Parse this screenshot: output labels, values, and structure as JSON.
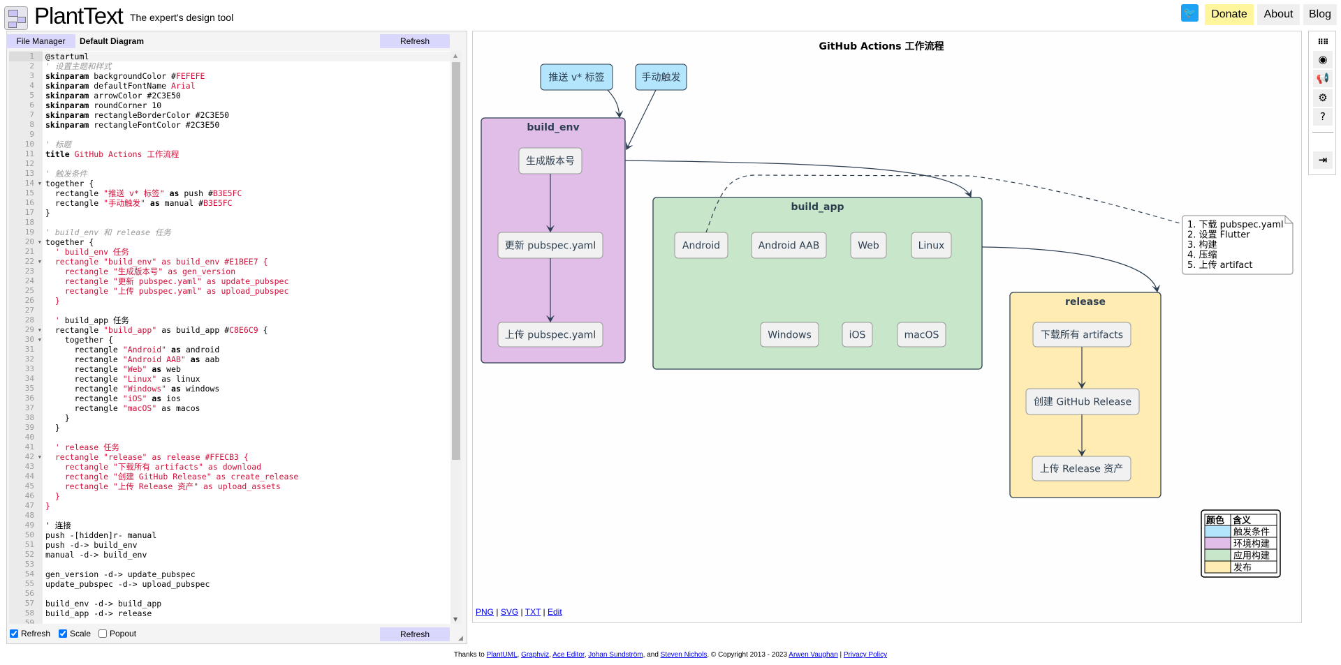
{
  "header": {
    "brand": "PlantText",
    "tagline": "The expert's design tool",
    "twitter_icon": "twitter-icon",
    "donate": "Donate",
    "about": "About",
    "blog": "Blog",
    "donate_color": "#fff59d"
  },
  "editor_toolbar": {
    "file_manager": "File Manager",
    "diagram_name": "Default Diagram",
    "refresh": "Refresh"
  },
  "editor": {
    "lines": [
      [
        [
          "t",
          "@startuml"
        ]
      ],
      [
        [
          "c",
          "' 设置主题和样式"
        ]
      ],
      [
        [
          "k",
          "skinparam"
        ],
        [
          "t",
          " backgroundColor #"
        ],
        [
          "s",
          "FEFEFE"
        ]
      ],
      [
        [
          "k",
          "skinparam"
        ],
        [
          "t",
          " defaultFontName "
        ],
        [
          "s",
          "Arial"
        ]
      ],
      [
        [
          "k",
          "skinparam"
        ],
        [
          "t",
          " arrowColor #2C3E50"
        ]
      ],
      [
        [
          "k",
          "skinparam"
        ],
        [
          "t",
          " roundCorner 10"
        ]
      ],
      [
        [
          "k",
          "skinparam"
        ],
        [
          "t",
          " rectangleBorderColor #2C3E50"
        ]
      ],
      [
        [
          "k",
          "skinparam"
        ],
        [
          "t",
          " rectangleFontColor #2C3E50"
        ]
      ],
      [],
      [
        [
          "c",
          "' 标题"
        ]
      ],
      [
        [
          "k",
          "title"
        ],
        [
          "s",
          " GitHub Actions 工作流程"
        ]
      ],
      [],
      [
        [
          "c",
          "' 触发条件"
        ]
      ],
      [
        [
          "t",
          "together {"
        ]
      ],
      [
        [
          "t",
          "  rectangle "
        ],
        [
          "s",
          "\"推送 v* 标签\""
        ],
        [
          "t",
          " "
        ],
        [
          "k",
          "as"
        ],
        [
          "t",
          " push #"
        ],
        [
          "s",
          "B3E5FC"
        ]
      ],
      [
        [
          "t",
          "  rectangle "
        ],
        [
          "s",
          "\"手动触发\""
        ],
        [
          "t",
          " "
        ],
        [
          "k",
          "as"
        ],
        [
          "t",
          " manual #"
        ],
        [
          "s",
          "B3E5FC"
        ]
      ],
      [
        [
          "t",
          "}"
        ]
      ],
      [],
      [
        [
          "c",
          "' build_env 和 release 任务"
        ]
      ],
      [
        [
          "t",
          "together {"
        ]
      ],
      [
        [
          "s",
          "  ' build_env 任务"
        ]
      ],
      [
        [
          "s",
          "  rectangle \"build_env\" as build_env #E1BEE7 {"
        ]
      ],
      [
        [
          "s",
          "    rectangle \"生成版本号\" as gen_version"
        ]
      ],
      [
        [
          "s",
          "    rectangle \"更新 pubspec.yaml\" as update_pubspec"
        ]
      ],
      [
        [
          "s",
          "    rectangle \"上传 pubspec.yaml\" as upload_pubspec"
        ]
      ],
      [
        [
          "s",
          "  }"
        ]
      ],
      [],
      [
        [
          "s",
          "  '"
        ],
        [
          "t",
          " build_app 任务"
        ]
      ],
      [
        [
          "t",
          "  rectangle "
        ],
        [
          "s",
          "\"build_app\""
        ],
        [
          "t",
          " as build_app #"
        ],
        [
          "s",
          "C8E6C9"
        ],
        [
          "t",
          " {"
        ]
      ],
      [
        [
          "t",
          "    together {"
        ]
      ],
      [
        [
          "t",
          "      rectangle "
        ],
        [
          "s",
          "\"Android\""
        ],
        [
          "t",
          " "
        ],
        [
          "k",
          "as"
        ],
        [
          "t",
          " android"
        ]
      ],
      [
        [
          "t",
          "      rectangle "
        ],
        [
          "s",
          "\"Android AAB\""
        ],
        [
          "t",
          " "
        ],
        [
          "k",
          "as"
        ],
        [
          "t",
          " aab"
        ]
      ],
      [
        [
          "t",
          "      rectangle "
        ],
        [
          "s",
          "\"Web\""
        ],
        [
          "t",
          " "
        ],
        [
          "k",
          "as"
        ],
        [
          "t",
          " web"
        ]
      ],
      [
        [
          "t",
          "      rectangle "
        ],
        [
          "s",
          "\"Linux\""
        ],
        [
          "t",
          " as linux"
        ]
      ],
      [
        [
          "t",
          "      rectangle "
        ],
        [
          "s",
          "\"Windows\""
        ],
        [
          "t",
          " "
        ],
        [
          "k",
          "as"
        ],
        [
          "t",
          " windows"
        ]
      ],
      [
        [
          "t",
          "      rectangle "
        ],
        [
          "s",
          "\"iOS\""
        ],
        [
          "t",
          " "
        ],
        [
          "k",
          "as"
        ],
        [
          "t",
          " ios"
        ]
      ],
      [
        [
          "t",
          "      rectangle "
        ],
        [
          "s",
          "\"macOS\""
        ],
        [
          "t",
          " as macos"
        ]
      ],
      [
        [
          "t",
          "    }"
        ]
      ],
      [
        [
          "t",
          "  }"
        ]
      ],
      [],
      [
        [
          "s",
          "  ' release 任务"
        ]
      ],
      [
        [
          "s",
          "  rectangle \"release\" as release #FFECB3 {"
        ]
      ],
      [
        [
          "s",
          "    rectangle \"下载所有 artifacts\" as download"
        ]
      ],
      [
        [
          "s",
          "    rectangle \"创建 GitHub Release\" as create_release"
        ]
      ],
      [
        [
          "s",
          "    rectangle \"上传 Release 资产\" as upload_assets"
        ]
      ],
      [
        [
          "s",
          "  }"
        ]
      ],
      [
        [
          "s",
          "}"
        ]
      ],
      [],
      [
        [
          "t",
          "' 连接"
        ]
      ],
      [
        [
          "t",
          "push -[hidden]r- manual"
        ]
      ],
      [
        [
          "t",
          "push -d-> build_env"
        ]
      ],
      [
        [
          "t",
          "manual -d-> build_env"
        ]
      ],
      [],
      [
        [
          "t",
          "gen_version -d-> update_pubspec"
        ]
      ],
      [
        [
          "t",
          "update_pubspec -d-> upload_pubspec"
        ]
      ],
      [],
      [
        [
          "t",
          "build_env -d-> build_app"
        ]
      ],
      [
        [
          "t",
          "build_app -d-> release"
        ]
      ],
      []
    ],
    "fold_lines": [
      14,
      20,
      22,
      29,
      30,
      42
    ]
  },
  "editor_footer": {
    "refresh_label": "Refresh",
    "refresh_checked": true,
    "scale_label": "Scale",
    "scale_checked": true,
    "popout_label": "Popout",
    "popout_checked": false,
    "refresh_button": "Refresh"
  },
  "diagram": {
    "title": "GitHub Actions 工作流程",
    "triggers": [
      {
        "label": "推送 v* 标签",
        "color": "#B3E5FC"
      },
      {
        "label": "手动触发",
        "color": "#B3E5FC"
      }
    ],
    "groups": {
      "build_env": {
        "label": "build_env",
        "color": "#E1BEE7",
        "items": [
          "生成版本号",
          "更新 pubspec.yaml",
          "上传 pubspec.yaml"
        ]
      },
      "build_app": {
        "label": "build_app",
        "color": "#C8E6C9",
        "items": [
          "Android",
          "Android AAB",
          "Web",
          "Linux",
          "Windows",
          "iOS",
          "macOS"
        ]
      },
      "release": {
        "label": "release",
        "color": "#FFECB3",
        "items": [
          "下载所有 artifacts",
          "创建 GitHub Release",
          "上传 Release 资产"
        ]
      }
    },
    "note": [
      "1. 下载 pubspec.yaml",
      "2. 设置 Flutter",
      "3. 构建",
      "4. 压缩",
      "5. 上传 artifact"
    ],
    "legend": {
      "headers": [
        "颜色",
        "含义"
      ],
      "rows": [
        {
          "color": "#B3E5FC",
          "label": "触发条件"
        },
        {
          "color": "#E1BEE7",
          "label": "环境构建"
        },
        {
          "color": "#C8E6C9",
          "label": "应用构建"
        },
        {
          "color": "#FFECB3",
          "label": "发布"
        }
      ]
    },
    "arrow_color": "#2C3E50",
    "node_fill": "#F1F1F1"
  },
  "output_links": [
    "PNG",
    "SVG",
    "TXT",
    "Edit"
  ],
  "right_toolbar": [
    "grid-icon",
    "eye-icon",
    "megaphone-icon",
    "gear-icon",
    "help-icon",
    "login-icon"
  ],
  "footer": {
    "thanks": "Thanks to",
    "links": [
      "PlantUML",
      "Graphviz",
      "Ace Editor",
      "Johan Sundström",
      "Steven Nichols"
    ],
    "and": "and",
    "copyright": ". © Copyright 2013 - 2023",
    "author": "Arwen Vaughan",
    "privacy": "Privacy Policy"
  }
}
